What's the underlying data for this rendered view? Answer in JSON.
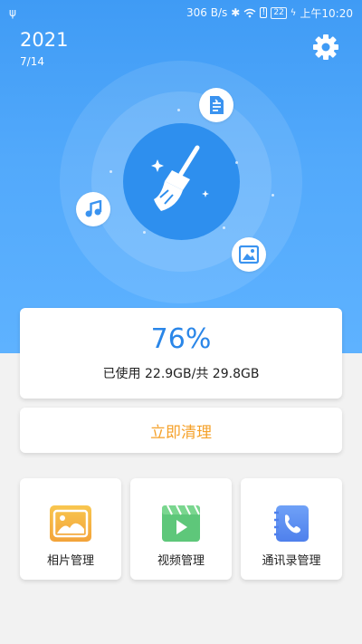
{
  "status_bar": {
    "network_speed": "306 B/s",
    "battery": "22",
    "time": "上午10:20"
  },
  "header": {
    "year": "2021",
    "date": "7/14"
  },
  "storage": {
    "percent_text": "76%",
    "percent_value": 0.76,
    "usage_text": "已使用 22.9GB/共 29.8GB"
  },
  "clean": {
    "label": "立即清理"
  },
  "tools": [
    {
      "label": "相片管理",
      "icon": "photo-icon",
      "color": "#f6b746"
    },
    {
      "label": "视频管理",
      "icon": "video-icon",
      "color": "#5ec77a"
    },
    {
      "label": "通讯录管理",
      "icon": "contacts-icon",
      "color": "#5a8df2"
    }
  ],
  "colors": {
    "hero_top": "#3f9bf5",
    "accent_blue": "#2a86e8",
    "clean_orange": "#f5a12a"
  }
}
